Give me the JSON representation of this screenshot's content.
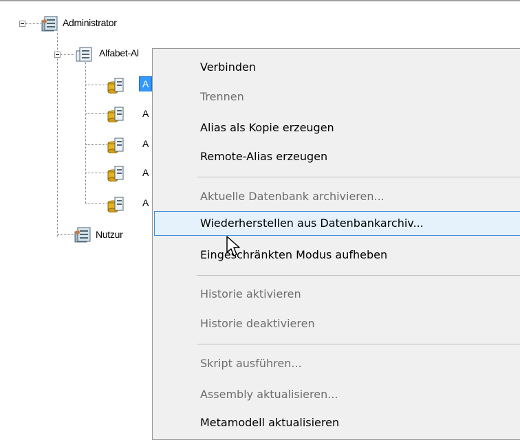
{
  "tree": {
    "root": {
      "label": "Administrator",
      "icon": "database-user-icon"
    },
    "child": {
      "label": "Alfabet-Alias",
      "visible_label": "Alfabet-Al",
      "icon": "database-folder-icon"
    },
    "aliases": [
      {
        "label": "A",
        "icon": "database-yellow-icon",
        "selected": true
      },
      {
        "label": "A",
        "icon": "database-yellow-icon"
      },
      {
        "label": "A",
        "icon": "database-yellow-icon"
      },
      {
        "label": "A",
        "icon": "database-yellow-icon"
      },
      {
        "label": "A",
        "icon": "database-yellow-icon"
      }
    ],
    "users": {
      "label": "Nutzer",
      "visible_label": "Nutzur",
      "icon": "database-user-icon"
    }
  },
  "context_menu": {
    "items": [
      {
        "label": "Verbinden",
        "enabled": true
      },
      {
        "label": "Trennen",
        "enabled": false
      },
      {
        "label": "Alias als Kopie erzeugen",
        "enabled": true
      },
      {
        "label": "Remote-Alias erzeugen",
        "enabled": true
      },
      {
        "separator": true
      },
      {
        "label": "Aktuelle Datenbank archivieren...",
        "enabled": false
      },
      {
        "label": "Wiederherstellen aus Datenbankarchiv...",
        "enabled": true,
        "hover": true
      },
      {
        "label": "Eingeschränkten Modus aufheben",
        "enabled": true
      },
      {
        "separator": true
      },
      {
        "label": "Historie aktivieren",
        "enabled": false
      },
      {
        "label": "Historie deaktivieren",
        "enabled": false
      },
      {
        "separator": true
      },
      {
        "label": "Skript ausführen...",
        "enabled": false
      },
      {
        "label": "Assembly aktualisieren...",
        "enabled": false
      },
      {
        "label": "Metamodell aktualisieren",
        "enabled": true
      }
    ]
  },
  "colors": {
    "menu_bg": "#f0f0f0",
    "hover_bg": "#e5f1fb",
    "hover_border": "#3e8ddd",
    "disabled_text": "#6d6d6d",
    "selection": "#3399ff"
  }
}
